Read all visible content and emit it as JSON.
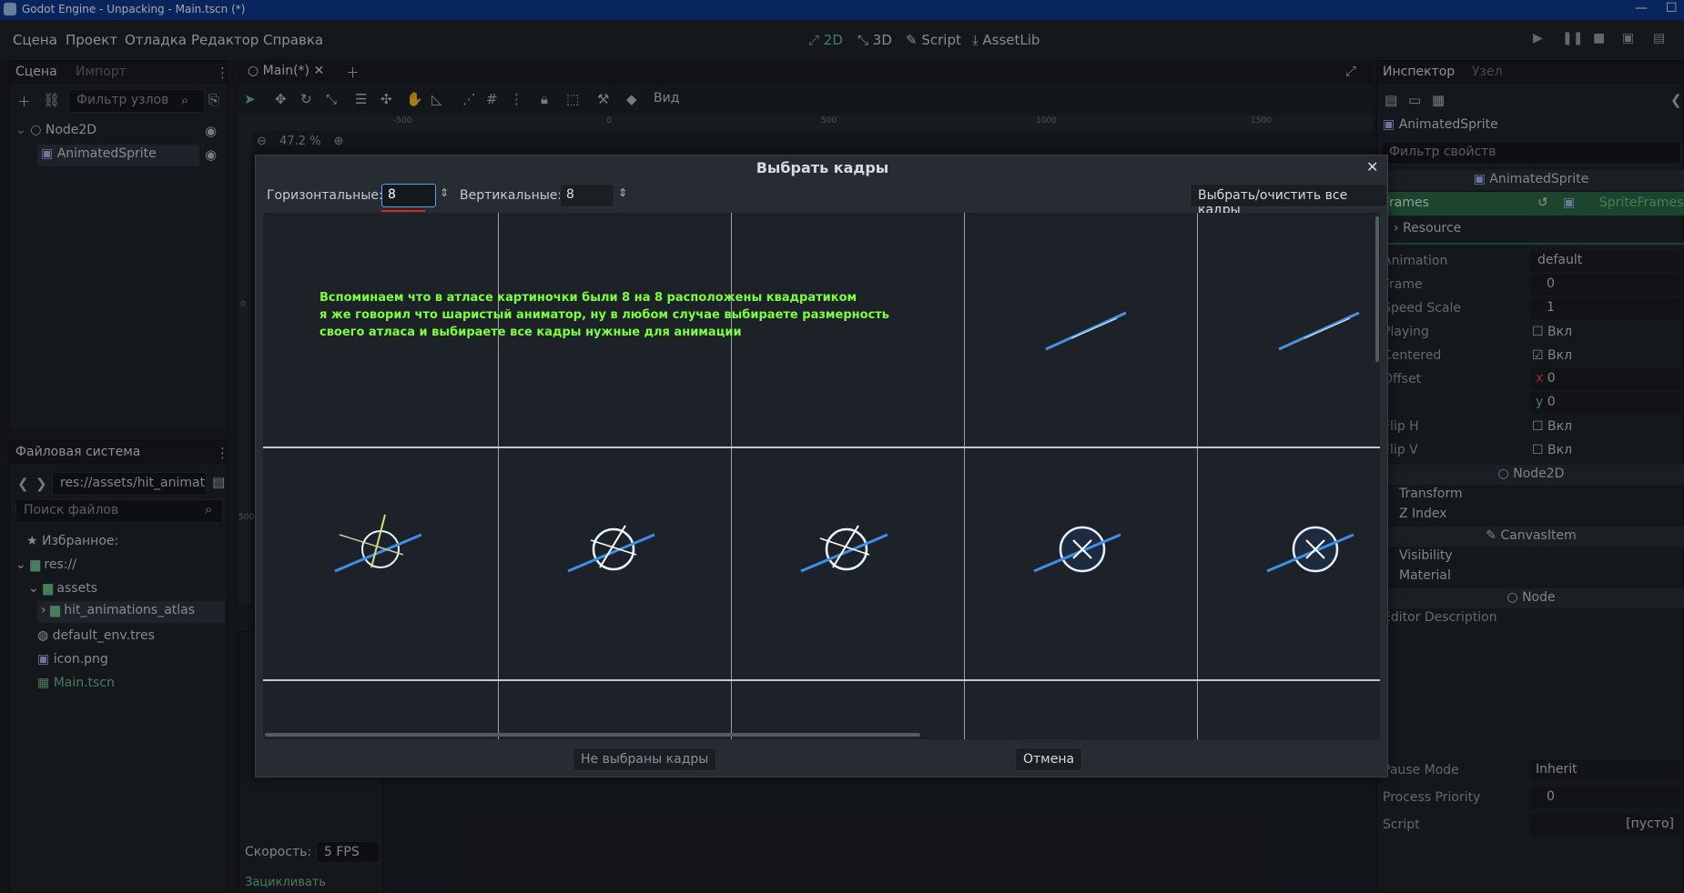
{
  "titlebar": {
    "title": "Godot Engine - Unpacking - Main.tscn (*)",
    "minimize": "—",
    "maximize": "☐"
  },
  "menus": [
    "Сцена",
    "Проект",
    "Отладка",
    "Редактор",
    "Справка"
  ],
  "modes": [
    "2D",
    "3D",
    "Script",
    "AssetLib"
  ],
  "scene_panel": {
    "tabs": [
      "Сцена",
      "Импорт"
    ],
    "filter_placeholder": "Фильтр узлов",
    "nodes": [
      "Node2D",
      "AnimatedSprite"
    ]
  },
  "viewport": {
    "tab": "Main(*)",
    "view_label": "Вид",
    "zoom": "47.2 %",
    "ruler": [
      "-500",
      "0",
      "500",
      "1000",
      "1500"
    ],
    "ruler_v": [
      "0",
      "500"
    ]
  },
  "filesystem": {
    "title": "Файловая система",
    "path": "res://assets/hit_animat",
    "search_placeholder": "Поиск файлов",
    "items": [
      "Избранное:",
      "res://",
      "assets",
      "hit_animations_atlas",
      "default_env.tres",
      "icon.png",
      "Main.tscn"
    ]
  },
  "bottom_panel": {
    "speed_label": "Скорость:",
    "speed_value": "5 FPS",
    "fragment_label": "Зацикливать"
  },
  "inspector": {
    "tabs": [
      "Инспектор",
      "Узел"
    ],
    "node": "Node",
    "filter": "Фильтр свойств",
    "class_header": "AnimatedSprite",
    "frames_label": "Frames",
    "frames_value": "SpriteFrames",
    "resource": "Resource",
    "props": [
      {
        "name": "Animation",
        "value": "default"
      },
      {
        "name": "Frame",
        "value": "0"
      },
      {
        "name": "Speed Scale",
        "value": "1"
      },
      {
        "name": "Playing",
        "value": "Вкл"
      },
      {
        "name": "Centered",
        "value": "Вкл"
      },
      {
        "name": "Offset",
        "value": "0"
      },
      {
        "name": "",
        "value": "0"
      },
      {
        "name": "Flip H",
        "value": "Вкл"
      },
      {
        "name": "Flip V",
        "value": "Вкл"
      }
    ],
    "offset_x": "x",
    "offset_y": "y",
    "node2d": "Node2D",
    "transform": "Transform",
    "zindex": "Z Index",
    "canvasitem": "CanvasItem",
    "visibility": "Visibility",
    "material": "Material",
    "editor_description": "Editor Description",
    "pause_mode": "Pause Mode",
    "pause_value": "Inherit",
    "priority": "Process Priority",
    "priority_value": "0",
    "script": "Script",
    "script_value": "[пусто]"
  },
  "dialog": {
    "title": "Выбрать кадры",
    "close": "✕",
    "h_label": "Горизонтальные:",
    "h_value": "8",
    "v_label": "Вертикальные:",
    "v_value": "8",
    "select_all": "Выбрать/очистить все кадры",
    "note": [
      "Вспоминаем что в атласе картиночки были 8 на 8 расположены квадратиком",
      "я же говорил что шаристый аниматор, ну в любом случае выбираете размерность",
      "своего атласа и выбираете все кадры нужные для анимации"
    ],
    "no_frames": "Не выбраны кадры",
    "cancel": "Отмена"
  },
  "colors": {
    "accent": "#6fc08c",
    "titlebar": "#0f3a91",
    "note": "#7cff3a",
    "underline": "#e02020"
  }
}
